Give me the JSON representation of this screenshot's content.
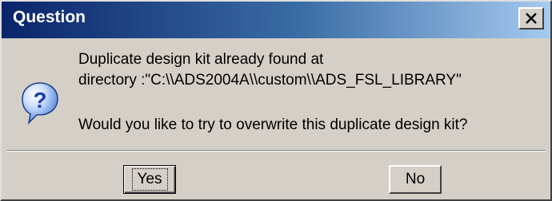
{
  "window": {
    "title": "Question",
    "close_label": "×"
  },
  "message": {
    "line1": "Duplicate design kit already found at",
    "line2": "directory :\"C:\\\\ADS2004A\\\\custom\\\\ADS_FSL_LIBRARY\"",
    "line3": "Would you like to try to overwrite this duplicate design kit?"
  },
  "buttons": {
    "yes_label": "Yes",
    "no_label": "No"
  },
  "icon": {
    "name": "question-icon",
    "glyph": "?",
    "color": "#2a5bd7"
  },
  "colors": {
    "titlebar_start": "#0a246a",
    "titlebar_end": "#a6caf0",
    "face": "#d4d0c8"
  }
}
